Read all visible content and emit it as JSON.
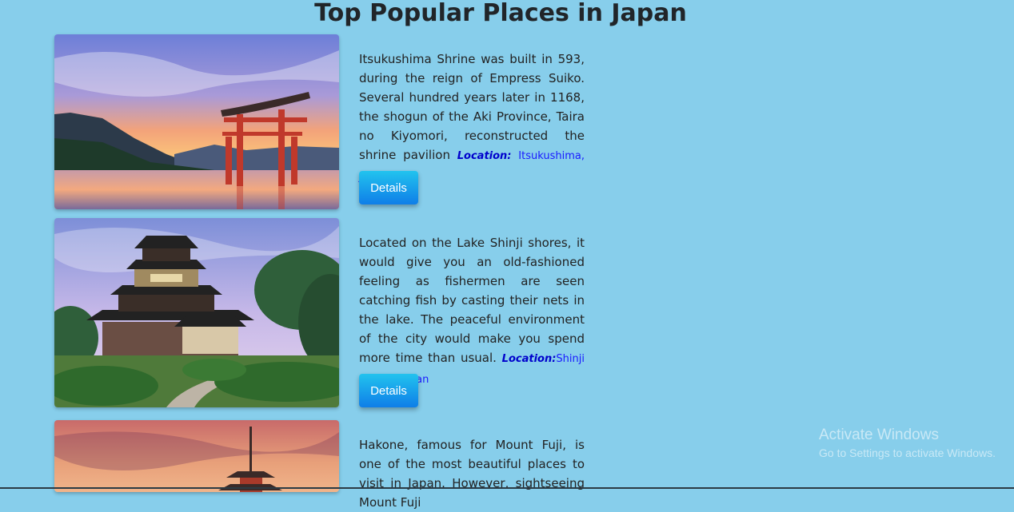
{
  "page": {
    "title": "Top Popular Places in Japan"
  },
  "places": [
    {
      "image": "itsukushima-torii-sunset-image",
      "description": "Itsukushima Shrine was built in 593, during the reign of Empress Suiko. Several hundred years later in 1168, the shogun of the Aki Province, Taira no Kiyomori, reconstructed the shrine pavilion",
      "location_label": "Location:",
      "location": "Itsukushima, Japan",
      "button": "Details"
    },
    {
      "image": "matsue-castle-garden-image",
      "description": "Located on the Lake Shinji shores, it would give you an old-fashioned feeling as fishermen are seen catching fish by casting their nets in the lake. The peaceful environment of the city would make you spend more time than usual.",
      "location_label": "Location:",
      "location": "Shinji shores, Japan",
      "button": "Details"
    },
    {
      "image": "hakone-pagoda-sunset-image",
      "description": "Hakone, famous for Mount Fuji, is one of the most beautiful places to visit in Japan. However, sightseeing Mount Fuji"
    }
  ],
  "watermark": {
    "title": "Activate Windows",
    "subtitle": "Go to Settings to activate Windows."
  }
}
